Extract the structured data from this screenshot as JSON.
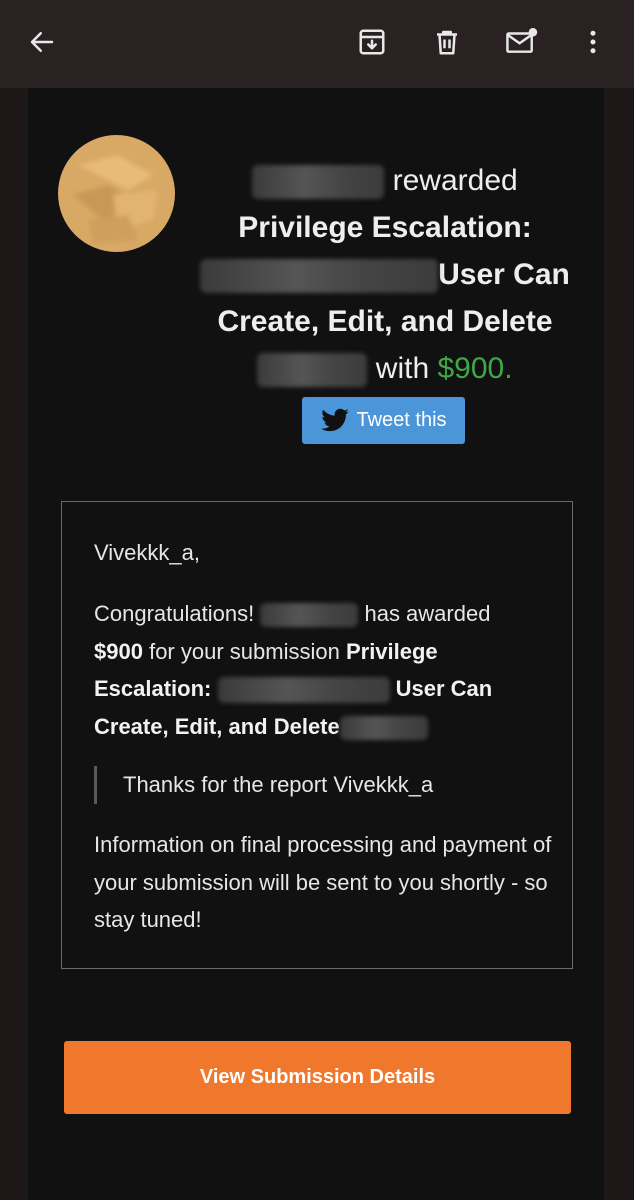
{
  "toolbar": {
    "back_icon": "arrow-left-icon",
    "archive_icon": "archive-icon",
    "delete_icon": "trash-icon",
    "mark_unread_icon": "mail-unread-icon",
    "more_icon": "more-vertical-icon"
  },
  "header": {
    "rewarded_text": "rewarded",
    "title_line1": "Privilege Escalation:",
    "title_line2": "User Can",
    "title_line3": "Create, Edit, and Delete",
    "with_text": "with",
    "amount": "$900."
  },
  "tweet_button": {
    "label": "Tweet this"
  },
  "message": {
    "greeting": "Vivekkk_a,",
    "congrats": "Congratulations!",
    "has_awarded": "has awarded",
    "amount": "$900",
    "for_submission": "for your submission",
    "title_part1": "Privilege",
    "title_part2": "Escalation:",
    "title_part3": "User Can",
    "title_part4": "Create, Edit, and Delete",
    "quote": "Thanks for the report Vivekkk_a",
    "info": "Information on final processing and payment of your submission will be sent to you shortly - so stay tuned!"
  },
  "cta_button": {
    "label": "View Submission Details"
  },
  "colors": {
    "background": "#1e1717",
    "app_bar": "#2a2222",
    "email_body": "#111111",
    "amount_green": "#3fa745",
    "tweet_blue": "#4a96d8",
    "cta_orange": "#f0782c"
  }
}
